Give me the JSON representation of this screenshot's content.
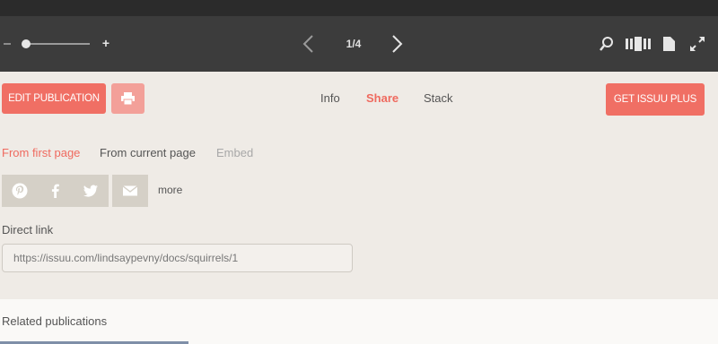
{
  "toolbar": {
    "page_indicator": "1/4",
    "zoom_minus": "−",
    "zoom_plus": "+",
    "zoom_level_fraction": 0.05
  },
  "actions": {
    "edit_publication": "EDIT PUBLICATION",
    "get_plus": "GET ISSUU PLUS"
  },
  "tabs": [
    {
      "label": "Info",
      "active": false
    },
    {
      "label": "Share",
      "active": true
    },
    {
      "label": "Stack",
      "active": false
    }
  ],
  "share": {
    "subtabs": [
      {
        "label": "From first page",
        "active": true
      },
      {
        "label": "From current page",
        "active": false
      },
      {
        "label": "Embed",
        "active": false
      }
    ],
    "social_icons": [
      "pinterest-icon",
      "facebook-icon",
      "twitter-icon",
      "email-icon"
    ],
    "more_label": "more",
    "direct_link_label": "Direct link",
    "direct_link_value": "https://issuu.com/lindsaypevny/docs/squirrels/1"
  },
  "related": {
    "title": "Related publications"
  },
  "colors": {
    "accent": "#f06f64",
    "toolbar_bg": "#3c3c3c",
    "page_bg": "#efebe6",
    "social_bg": "#d5d0c7"
  }
}
